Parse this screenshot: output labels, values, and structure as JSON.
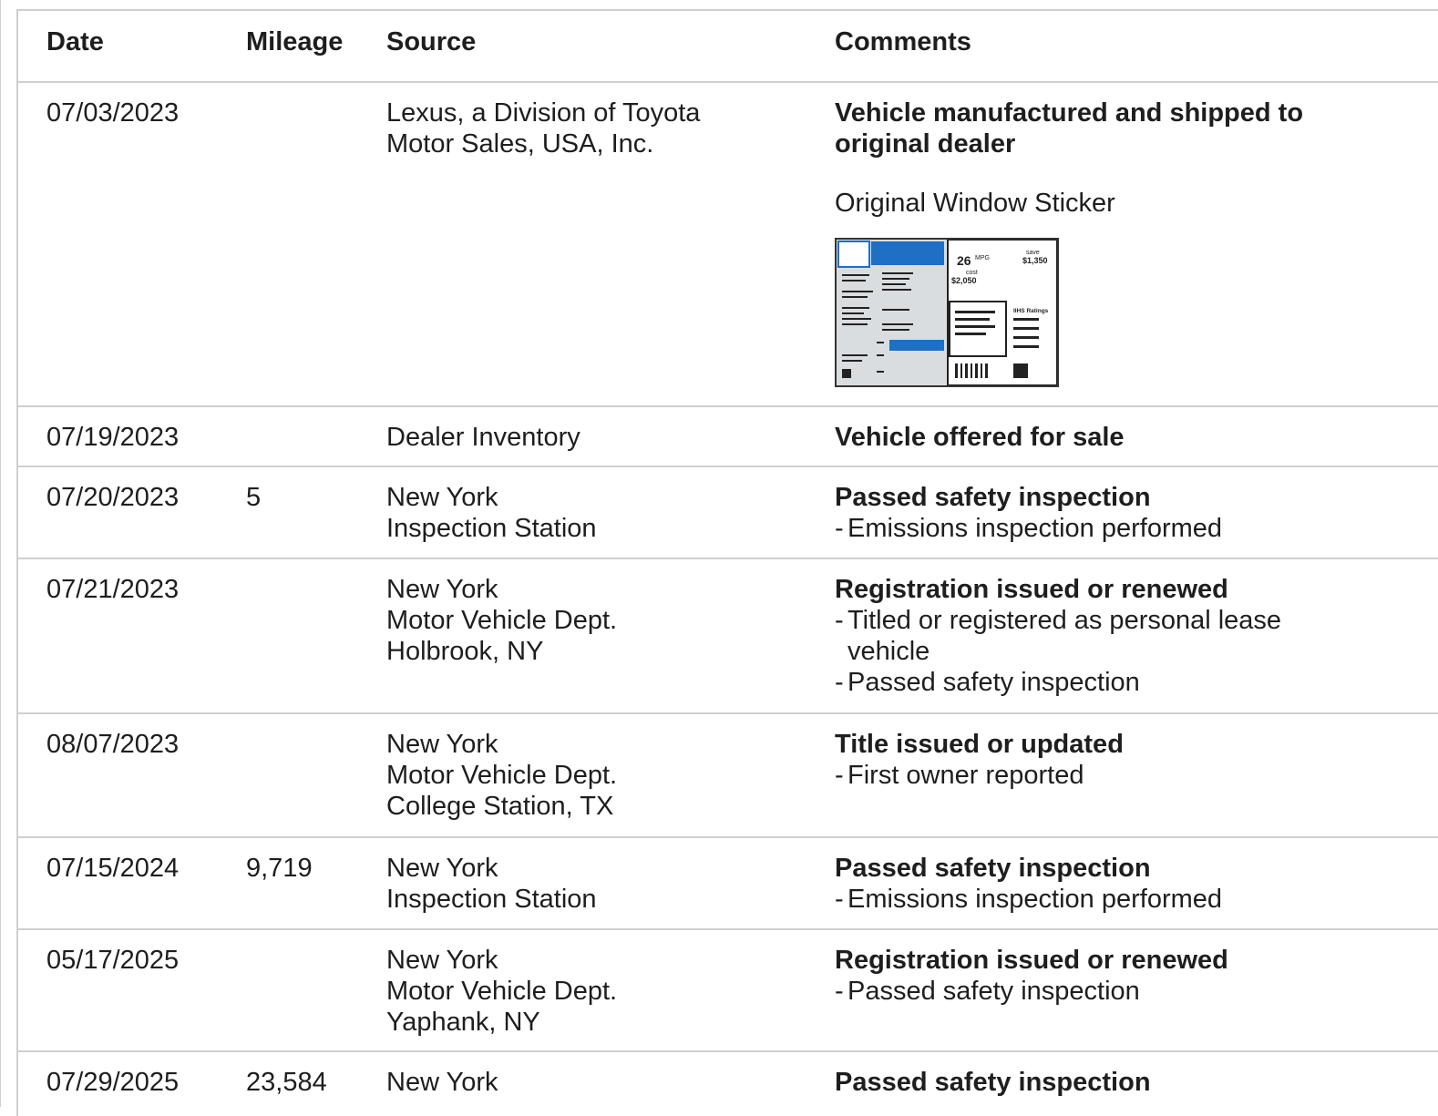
{
  "table": {
    "headers": {
      "date": "Date",
      "mileage": "Mileage",
      "source": "Source",
      "comments": "Comments"
    },
    "rows": [
      {
        "date": "07/03/2023",
        "mileage": "",
        "source": [
          "Lexus, a Division of Toyota",
          "Motor Sales, USA, Inc."
        ],
        "title": "Vehicle manufactured and shipped to original dealer",
        "bullets": [],
        "sticker_label": "Original Window Sticker"
      },
      {
        "date": "07/19/2023",
        "mileage": "",
        "source": [
          "Dealer Inventory"
        ],
        "title": "Vehicle offered for sale",
        "bullets": []
      },
      {
        "date": "07/20/2023",
        "mileage": "5",
        "source": [
          "New York",
          "Inspection Station"
        ],
        "title": "Passed safety inspection",
        "bullets": [
          "Emissions inspection performed"
        ]
      },
      {
        "date": "07/21/2023",
        "mileage": "",
        "source": [
          "New York",
          "Motor Vehicle Dept.",
          "Holbrook, NY"
        ],
        "title": "Registration issued or renewed",
        "bullets": [
          "Titled or registered as personal lease vehicle",
          "Passed safety inspection"
        ]
      },
      {
        "date": "08/07/2023",
        "mileage": "",
        "source": [
          "New York",
          "Motor Vehicle Dept.",
          "College Station, TX"
        ],
        "title": "Title issued or updated",
        "bullets": [
          "First owner reported"
        ]
      },
      {
        "date": "07/15/2024",
        "mileage": "9,719",
        "source": [
          "New York",
          "Inspection Station"
        ],
        "title": "Passed safety inspection",
        "bullets": [
          "Emissions inspection performed"
        ]
      },
      {
        "date": "05/17/2025",
        "mileage": "",
        "source": [
          "New York",
          "Motor Vehicle Dept.",
          "Yaphank, NY"
        ],
        "title": "Registration issued or renewed",
        "bullets": [
          "Passed safety inspection"
        ]
      },
      {
        "date": "07/29/2025",
        "mileage": "23,584",
        "source": [
          "New York"
        ],
        "title": "Passed safety inspection",
        "bullets": []
      }
    ]
  },
  "sticker": {
    "mpg": "26",
    "mpg_unit": "MPG",
    "save_label": "save",
    "save_amount": "$1,350",
    "cost_label": "cost",
    "cost_amount": "$2,050",
    "ratings_label": "IIHS Ratings",
    "accent_color": "#1f6fc5"
  }
}
